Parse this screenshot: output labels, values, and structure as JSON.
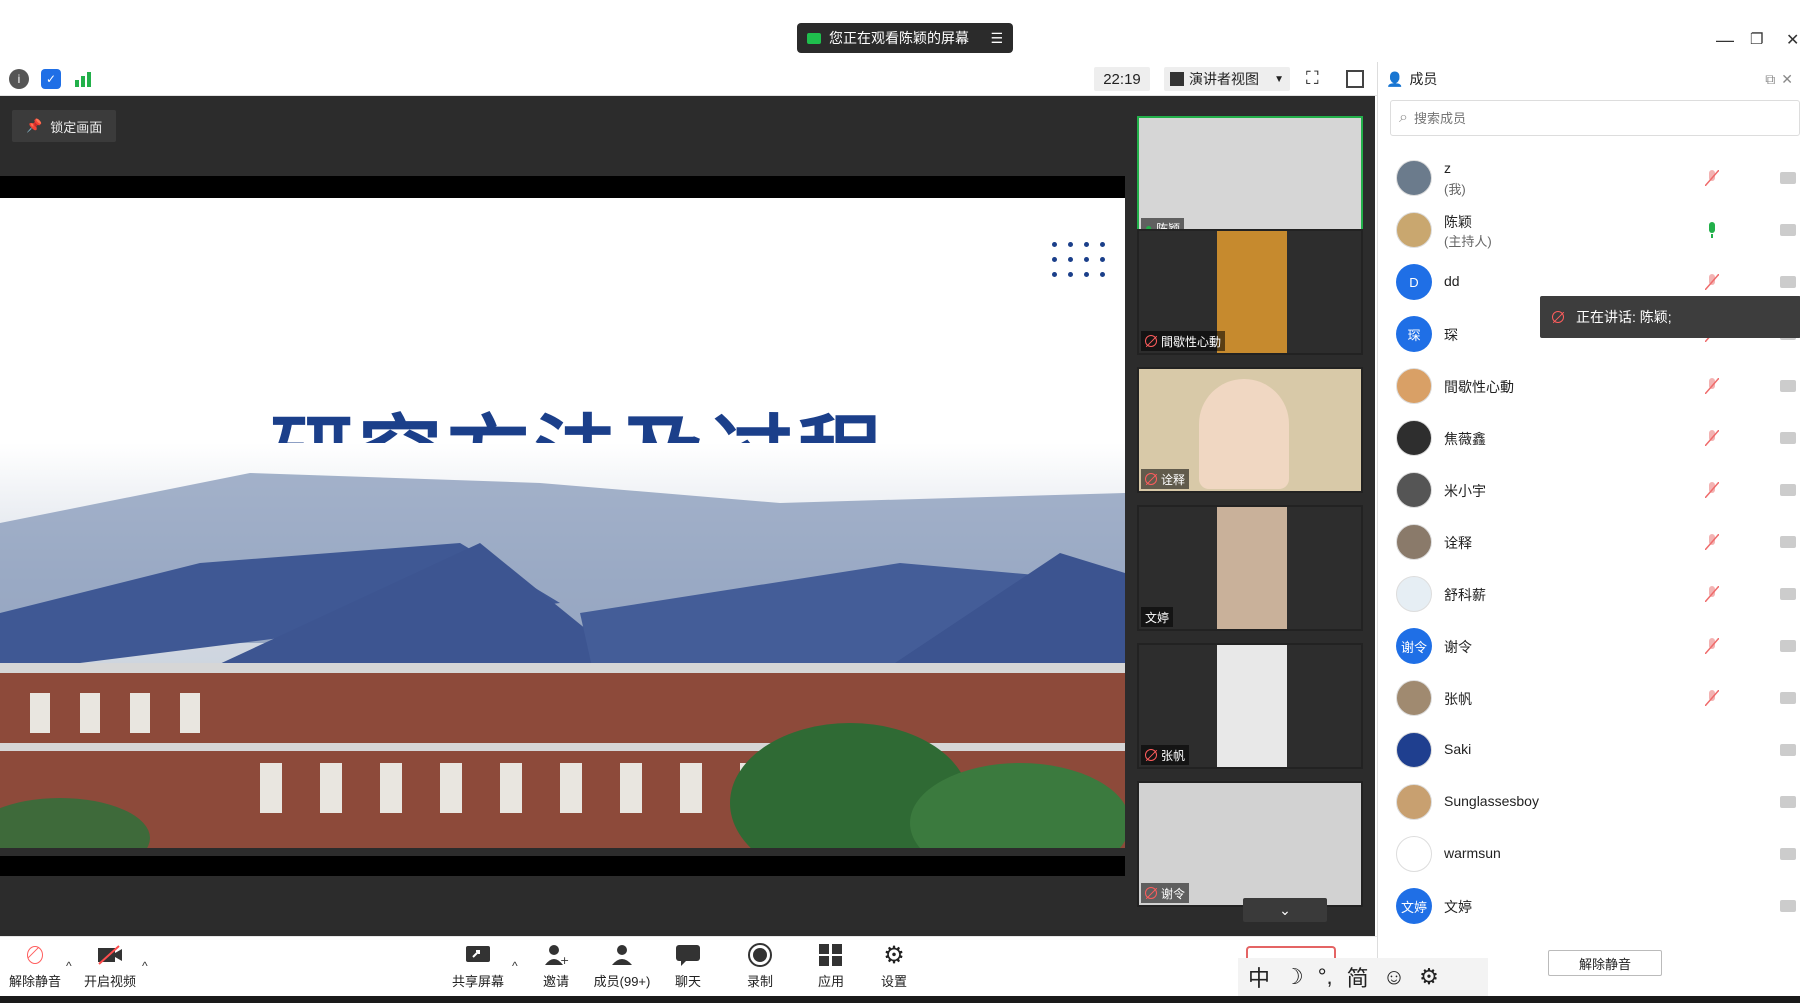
{
  "window": {
    "share_banner": "您正在观看陈颖的屏幕",
    "min": "—",
    "restore": "❐",
    "close": "✕"
  },
  "toolbar": {
    "time": "22:19",
    "view_label": "演讲者视图"
  },
  "stage": {
    "lock_label": "锁定画面",
    "slide_title": "研究方法及过程"
  },
  "video_tiles": [
    {
      "name": "陈颖",
      "active": true
    },
    {
      "name": "間歇性心動"
    },
    {
      "name": "诠释"
    },
    {
      "name": "文婷"
    },
    {
      "name": "张帆"
    },
    {
      "name": "谢令"
    }
  ],
  "panel": {
    "title": "成员",
    "search_placeholder": "搜索成员",
    "speaking": "正在讲话: 陈颖;",
    "unmute_all": "解除静音",
    "members": [
      {
        "name": "z",
        "role": "(我)",
        "avatar": "photo",
        "color": "#6b7b8c"
      },
      {
        "name": "陈颖",
        "role": "(主持人)",
        "avatar": "photo",
        "color": "#c9a76f"
      },
      {
        "name": "dd",
        "avatar": "D",
        "color": "#1f6fe6"
      },
      {
        "name": "琛",
        "avatar": "琛",
        "color": "#1f6fe6"
      },
      {
        "name": "間歇性心動",
        "avatar": "photo",
        "color": "#d9a066"
      },
      {
        "name": "焦薇鑫",
        "avatar": "photo",
        "color": "#2e2e2e"
      },
      {
        "name": "米小宇",
        "avatar": "photo",
        "color": "#555555"
      },
      {
        "name": "诠释",
        "avatar": "photo",
        "color": "#8a7a6a"
      },
      {
        "name": "舒科薪",
        "avatar": "photo",
        "color": "#e6eef4"
      },
      {
        "name": "谢令",
        "avatar": "谢令",
        "color": "#1f6fe6"
      },
      {
        "name": "张帆",
        "avatar": "photo",
        "color": "#a08a70"
      },
      {
        "name": "Saki",
        "avatar": "photo",
        "color": "#1f3f8f"
      },
      {
        "name": "Sunglassesboy",
        "avatar": "photo",
        "color": "#c8a070"
      },
      {
        "name": "warmsun",
        "avatar": "photo",
        "color": "#ffffff"
      },
      {
        "name": "文婷",
        "avatar": "文婷",
        "color": "#1f6fe6"
      }
    ]
  },
  "bottombar": {
    "unmute": "解除静音",
    "start_video": "开启视频",
    "share_screen": "共享屏幕",
    "invite": "邀请",
    "members": "成员(99+)",
    "chat": "聊天",
    "record": "录制",
    "apps": "应用",
    "settings": "设置"
  },
  "ime": {
    "lang": "中",
    "moon": "☽",
    "punct": "°,",
    "simp": "简",
    "smile": "☺",
    "gear": "⚙"
  }
}
